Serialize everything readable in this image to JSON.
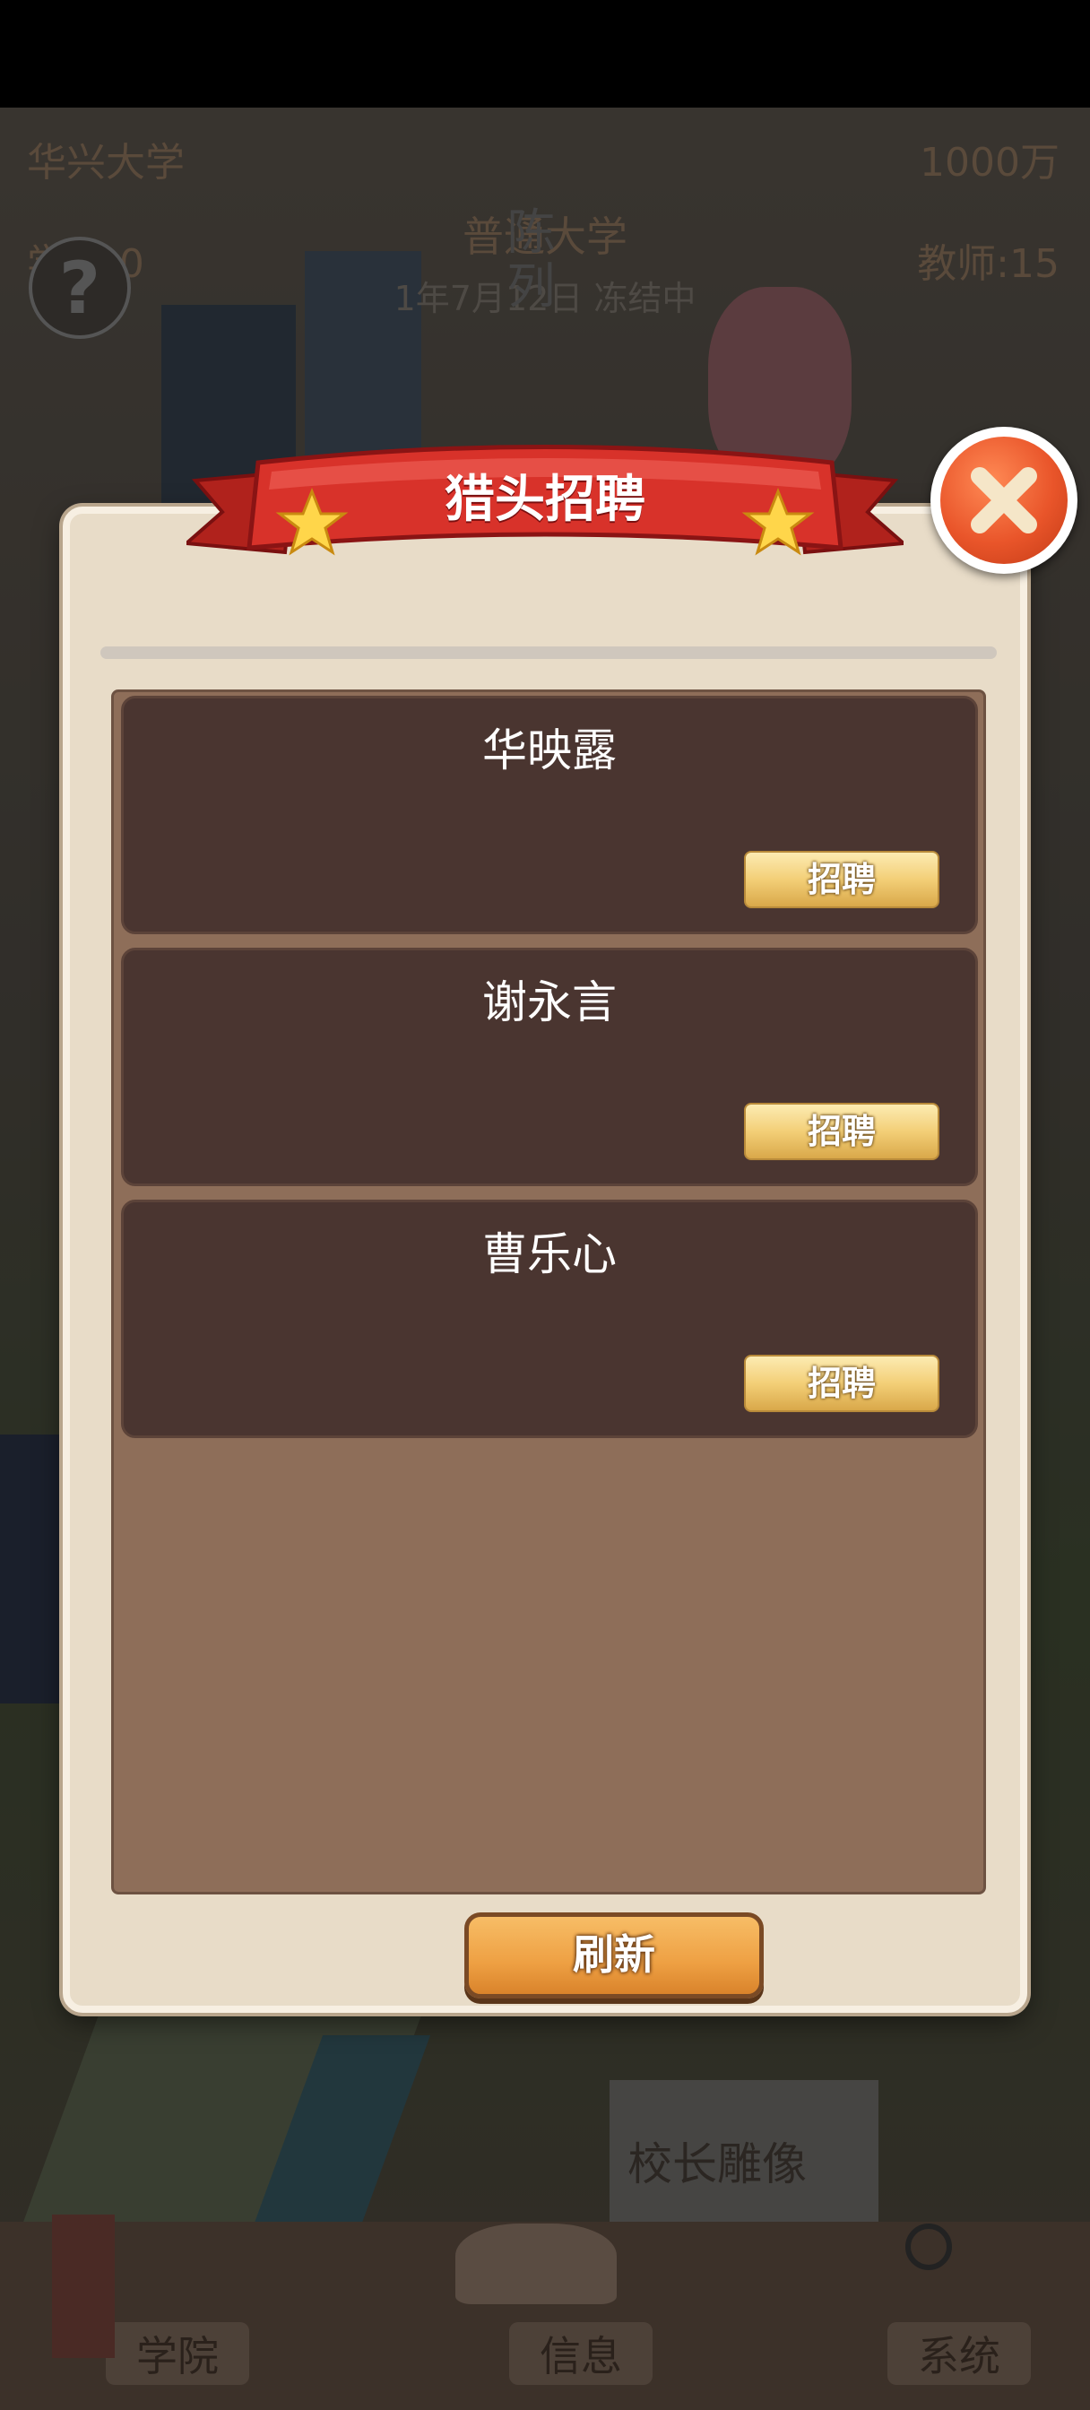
{
  "hud": {
    "university_name": "华兴大学",
    "money": "1000万",
    "students": "学生:0",
    "teachers": "教师:15",
    "level": "普通大学",
    "date_status": "1年7月12日 冻结中",
    "banner_text": "陈列",
    "statue_label": "校长雕像"
  },
  "dialog": {
    "title": "猎头招聘",
    "candidates": [
      {
        "name": "华映露",
        "hire_label": "招聘"
      },
      {
        "name": "谢永言",
        "hire_label": "招聘"
      },
      {
        "name": "曹乐心",
        "hire_label": "招聘"
      }
    ],
    "refresh_label": "刷新",
    "close_icon": "close-icon"
  },
  "bottom_nav": {
    "items": [
      {
        "label": "学院",
        "icon": "building-icon"
      },
      {
        "label": "信息",
        "icon": "book-icon"
      },
      {
        "label": "系统",
        "icon": "magnifier-icon"
      }
    ]
  },
  "colors": {
    "ribbon": "#d8322a",
    "card": "#4a3530",
    "list_bg": "#8e6e59",
    "dialog_bg": "#e8dcc8",
    "hire_button": "#f3cf77",
    "refresh_button": "#eea043",
    "close_button": "#e9552a"
  }
}
